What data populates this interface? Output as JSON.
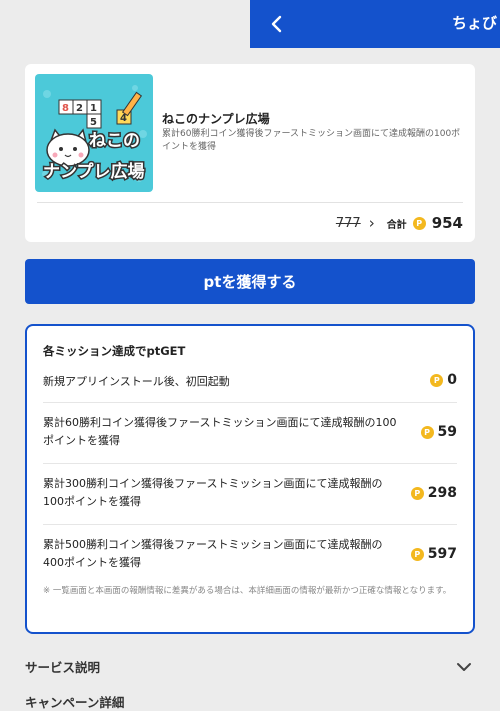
{
  "header": {
    "title": "ちょび",
    "back_icon": "chevron-left-icon"
  },
  "app": {
    "icon_text_line1": "ねこの",
    "icon_text_line2": "ナンプレ広場",
    "name": "ねこのナンプレ広場",
    "description": "累計60勝利コイン獲得後ファーストミッション画面にて達成報酬の100ポイントを獲得",
    "old_points": "777",
    "total_label": "合計",
    "coin_symbol": "P",
    "total_points": "954"
  },
  "get_button": {
    "label": "ptを獲得する"
  },
  "missions": {
    "title": "各ミッション達成でptGET",
    "items": [
      {
        "text": "新規アプリインストール後、初回起動",
        "points": "0"
      },
      {
        "text": "累計60勝利コイン獲得後ファーストミッション画面にて達成報酬の100ポイントを獲得",
        "points": "59"
      },
      {
        "text": "累計300勝利コイン獲得後ファーストミッション画面にて達成報酬の100ポイントを獲得",
        "points": "298"
      },
      {
        "text": "累計500勝利コイン獲得後ファーストミッション画面にて達成報酬の400ポイントを獲得",
        "points": "597"
      }
    ],
    "note": "※ 一覧画面と本画面の報酬情報に差異がある場合は、本詳細画面の情報が最新かつ正確な情報となります。"
  },
  "sections": {
    "service": "サービス説明",
    "campaign": "キャンペーン詳細"
  },
  "colors": {
    "brand": "#1452cc",
    "coin": "#f3b81f",
    "icon_bg": "#4cc9d9"
  }
}
